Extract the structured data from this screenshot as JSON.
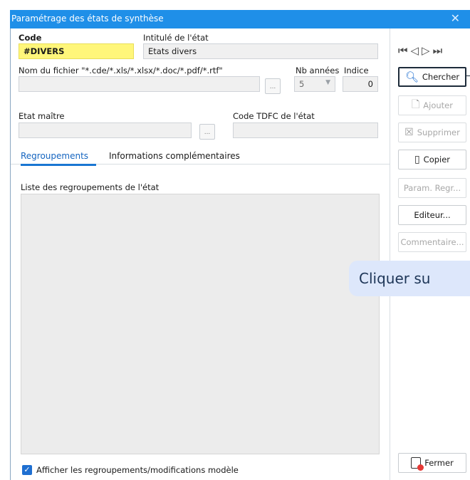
{
  "window": {
    "title": "Paramétrage des états de synthèse",
    "close_glyph": "✕"
  },
  "form": {
    "code_label": "Code",
    "code_value": "#DIVERS",
    "intitule_label": "Intitulé de l'état",
    "intitule_value": "Etats divers",
    "fichier_label": "Nom du fichier \"*.cde/*.xls/*.xlsx/*.doc/*.pdf/*.rtf\"",
    "fichier_value": "",
    "nb_annees_label": "Nb années",
    "nb_annees_value": "5",
    "indice_label": "Indice",
    "indice_value": "0",
    "etat_maitre_label": "Etat maître",
    "etat_maitre_value": "",
    "code_tdfc_label": "Code TDFC de l'état",
    "code_tdfc_value": "",
    "ellipsis": "..."
  },
  "tabs": [
    {
      "label": "Regroupements",
      "active": true
    },
    {
      "label": "Informations complémentaires",
      "active": false
    }
  ],
  "list": {
    "label": "Liste des regroupements de l'état"
  },
  "checkbox": {
    "checked": true,
    "label": "Afficher les regroupements/modifications modèle"
  },
  "nav": {
    "glyphs": "⏮◁▷⏭"
  },
  "buttons": {
    "chercher": "Chercher",
    "ajouter": "Ajouter",
    "supprimer": "Supprimer",
    "copier": "Copier",
    "param_regr": "Param. Regr...",
    "editeur": "Editeur...",
    "commentaire": "Commentaire...",
    "fermer": "Fermer"
  },
  "tooltip": {
    "text": "Cliquer su"
  },
  "colors": {
    "titlebar": "#1f8fe8",
    "code_field": "#fff67a",
    "tab_active": "#1976d2",
    "tooltip_bg": "#dde7fb"
  }
}
